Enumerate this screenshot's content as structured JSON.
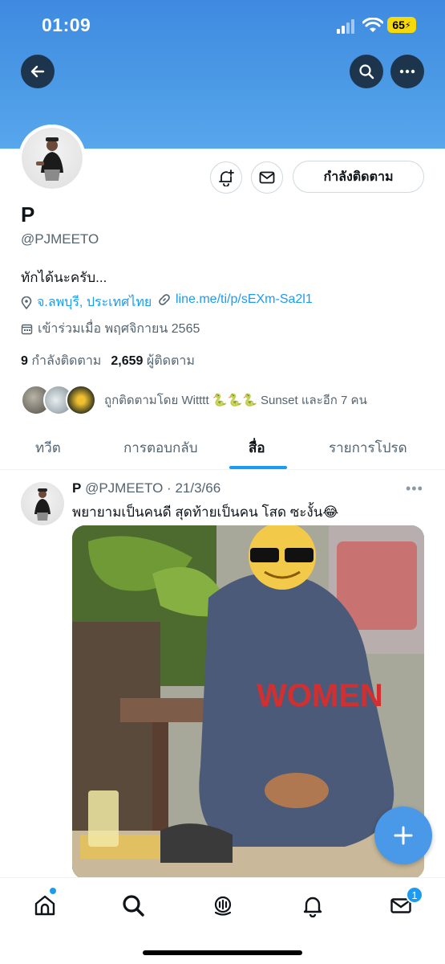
{
  "status_bar": {
    "time": "01:09",
    "battery": "65"
  },
  "profile": {
    "display_name": "P",
    "handle": "@PJMEETO",
    "bio": "ทักได้นะครับ...",
    "location": "จ.ลพบุรี, ประเทศไทย",
    "link": "line.me/ti/p/sEXm-Sa2l1",
    "joined": "เข้าร่วมเมื่อ พฤศจิกายน 2565",
    "following_count": "9",
    "following_label": "กำลังติดตาม",
    "followers_count": "2,659",
    "followers_label": "ผู้ติดตาม",
    "followed_by": "ถูกติดตามโดย Witttt 🐍🐍🐍 Sunset และอีก 7 คน",
    "follow_button": "กำลังติดตาม"
  },
  "tabs": [
    {
      "label": "ทวีต"
    },
    {
      "label": "การตอบกลับ"
    },
    {
      "label": "สื่อ",
      "active": true
    },
    {
      "label": "รายการโปรด"
    }
  ],
  "tweet": {
    "name": "P",
    "handle": "@PJMEETO",
    "date": "21/3/66",
    "text": "พยายามเป็นคนดี สุดท้ายเป็นคน โสด ซะงั้น😂",
    "image_shirt_text": "WOMEN"
  },
  "bottom_nav": {
    "messages_badge": "1"
  },
  "colors": {
    "accent": "#1d9bf0",
    "banner": "#4c9be6",
    "fab": "#4a99e9"
  }
}
